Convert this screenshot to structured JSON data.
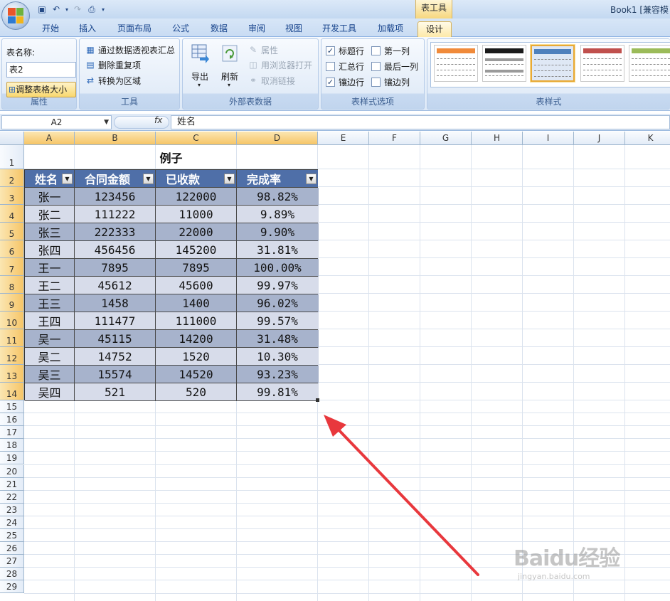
{
  "window": {
    "app_title": "Book1  [兼容模",
    "context_tab_title": "表工具"
  },
  "tabs": [
    "开始",
    "插入",
    "页面布局",
    "公式",
    "数据",
    "审阅",
    "视图",
    "开发工具",
    "加载项",
    "设计"
  ],
  "active_tab": "设计",
  "ribbon": {
    "properties": {
      "table_name_label": "表名称:",
      "table_name_value": "表2",
      "resize_label": "调整表格大小",
      "group_label": "属性"
    },
    "tools": {
      "pivot_label": "通过数据透视表汇总",
      "remove_dup_label": "删除重复项",
      "convert_label": "转换为区域",
      "group_label": "工具"
    },
    "external": {
      "export_label": "导出",
      "refresh_label": "刷新",
      "properties_label": "属性",
      "open_browser_label": "用浏览器打开",
      "unlink_label": "取消链接",
      "group_label": "外部表数据"
    },
    "style_options": {
      "header_row": {
        "label": "标题行",
        "checked": true
      },
      "total_row": {
        "label": "汇总行",
        "checked": false
      },
      "banded_rows": {
        "label": "镶边行",
        "checked": true
      },
      "first_col": {
        "label": "第一列",
        "checked": false
      },
      "last_col": {
        "label": "最后一列",
        "checked": false
      },
      "banded_cols": {
        "label": "镶边列",
        "checked": false
      },
      "group_label": "表样式选项"
    },
    "styles": {
      "group_label": "表样式",
      "swatch_colors": [
        "#f08a3a",
        "#1a1a1a",
        "#4f81bd",
        "#c0504d",
        "#9bbb59"
      ]
    }
  },
  "formula_bar": {
    "name_box": "A2",
    "fx_label": "fx",
    "formula": "姓名"
  },
  "columns": [
    "A",
    "B",
    "C",
    "D",
    "E",
    "F",
    "G",
    "H",
    "I",
    "J",
    "K"
  ],
  "rows": [
    "1",
    "2",
    "3",
    "4",
    "5",
    "6",
    "7",
    "8",
    "9",
    "10",
    "11",
    "12",
    "13",
    "14",
    "15",
    "16",
    "17",
    "18",
    "19",
    "20",
    "21",
    "22",
    "23",
    "24",
    "25",
    "26",
    "27",
    "28",
    "29"
  ],
  "sheet": {
    "title": "例子",
    "headers": [
      "姓名",
      "合同金额",
      "已收款",
      "完成率"
    ],
    "data": [
      [
        "张一",
        "123456",
        "122000",
        "98.82%"
      ],
      [
        "张二",
        "111222",
        "11000",
        "9.89%"
      ],
      [
        "张三",
        "222333",
        "22000",
        "9.90%"
      ],
      [
        "张四",
        "456456",
        "145200",
        "31.81%"
      ],
      [
        "王一",
        "7895",
        "7895",
        "100.00%"
      ],
      [
        "王二",
        "45612",
        "45600",
        "99.97%"
      ],
      [
        "王三",
        "1458",
        "1400",
        "96.02%"
      ],
      [
        "王四",
        "111477",
        "111000",
        "99.57%"
      ],
      [
        "吴一",
        "45115",
        "14200",
        "31.48%"
      ],
      [
        "吴二",
        "14752",
        "1520",
        "10.30%"
      ],
      [
        "吴三",
        "15574",
        "14520",
        "93.23%"
      ],
      [
        "吴四",
        "521",
        "520",
        "99.81%"
      ]
    ]
  },
  "watermark": {
    "main": "Baidu经验",
    "sub": "jingyan.baidu.com"
  },
  "colors": {
    "table_header": "#4f6fa8",
    "band_dark": "#a7b3cc",
    "band_light": "#d7dcea",
    "arrow": "#e8383d"
  }
}
